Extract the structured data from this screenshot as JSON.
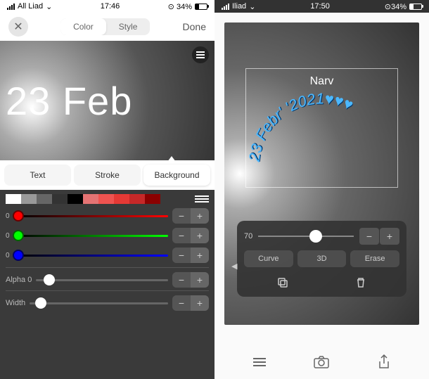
{
  "statusLeft": {
    "carrier": "All Liad",
    "time": "17:46",
    "battery": "34%"
  },
  "statusRight": {
    "carrier": "Iliad",
    "time": "17:50",
    "battery": "34%"
  },
  "topBar": {
    "seg1": "Color",
    "seg2": "Style",
    "done": "Done"
  },
  "canvas": {
    "dateText": "23 Feb"
  },
  "tabs": {
    "text": "Text",
    "stroke": "Stroke",
    "background": "Background"
  },
  "sliders": {
    "r": "0",
    "g": "0",
    "b": "0",
    "alpha": "Alpha 0",
    "width": "Width"
  },
  "rightPanel": {
    "narv": "Narv",
    "curved": "23 Febr' '2021♥♥♥",
    "sliderVal": "70",
    "curve": "Curve",
    "threeD": "3D",
    "erase": "Erase"
  }
}
